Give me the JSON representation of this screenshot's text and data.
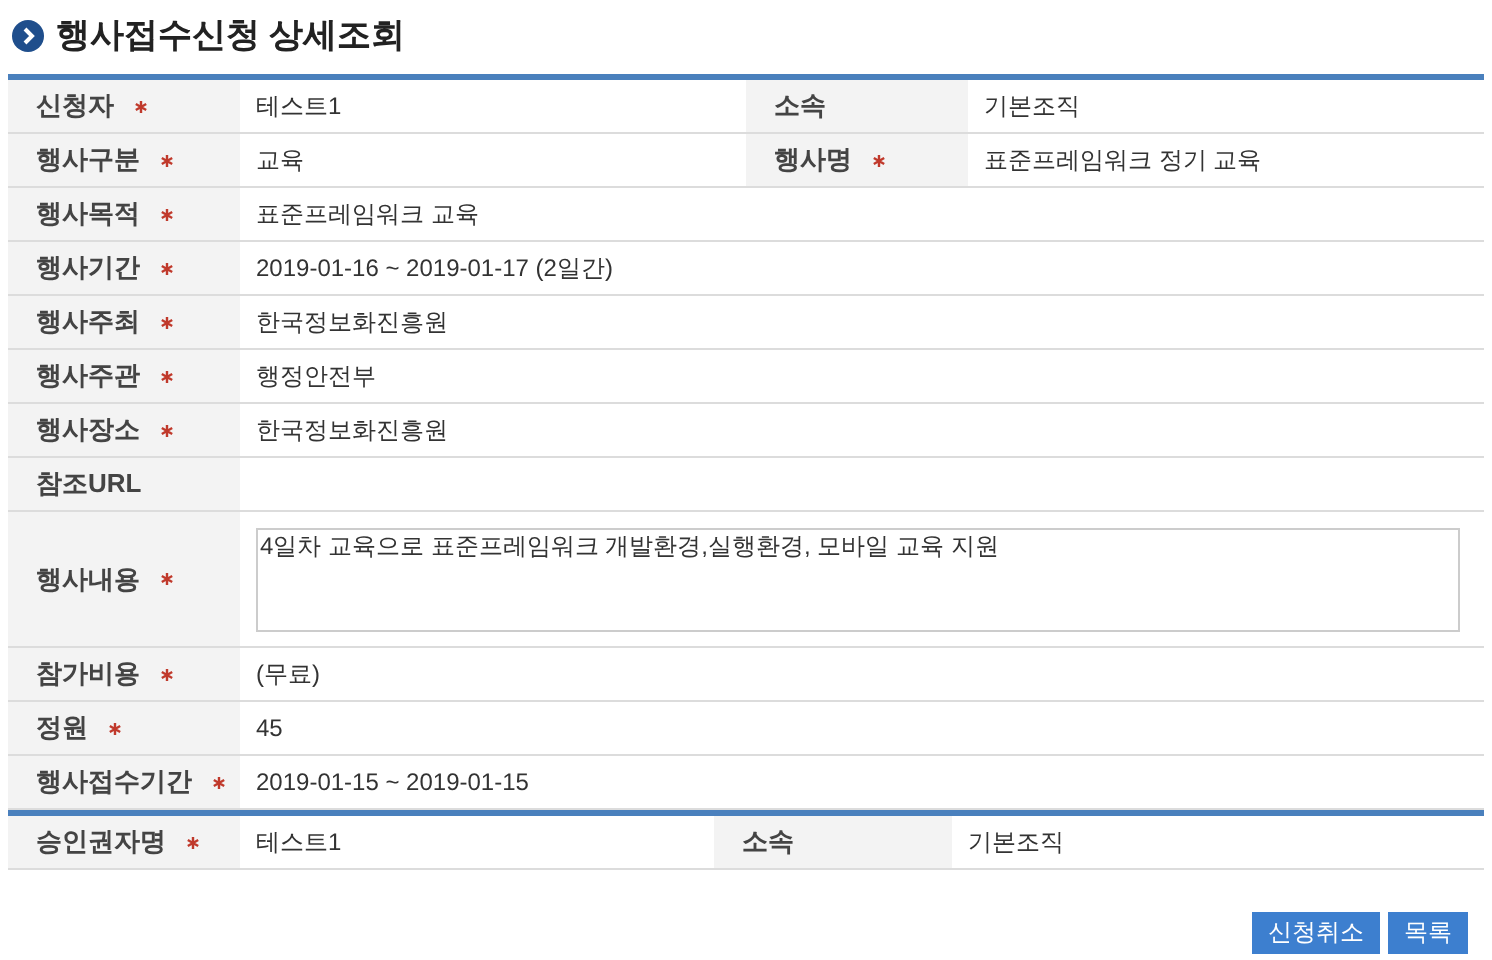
{
  "title": "행사접수신청 상세조회",
  "application": [
    {
      "kind": "pair",
      "label": "신청자",
      "required": true,
      "value": "테스트1",
      "label2": "소속",
      "required2": false,
      "value2": "기본조직"
    },
    {
      "kind": "pair",
      "label": "행사구분",
      "required": true,
      "value": "교육",
      "label2": "행사명",
      "required2": true,
      "value2": "표준프레임워크 정기 교육"
    },
    {
      "kind": "text",
      "label": "행사목적",
      "required": true,
      "value": "표준프레임워크 교육"
    },
    {
      "kind": "text",
      "label": "행사기간",
      "required": true,
      "value": "2019-01-16 ~ 2019-01-17 (2일간)"
    },
    {
      "kind": "text",
      "label": "행사주최",
      "required": true,
      "value": "한국정보화진흥원"
    },
    {
      "kind": "text",
      "label": "행사주관",
      "required": true,
      "value": "행정안전부"
    },
    {
      "kind": "text",
      "label": "행사장소",
      "required": true,
      "value": "한국정보화진흥원"
    },
    {
      "kind": "text",
      "label": "참조URL",
      "required": false
    },
    {
      "kind": "textarea",
      "label": "행사내용",
      "required": true,
      "value": "4일차 교육으로 표준프레임워크 개발환경,실행환경, 모바일 교육 지원"
    },
    {
      "kind": "text",
      "label": "참가비용",
      "required": true,
      "value": "(무료)"
    },
    {
      "kind": "text",
      "label": "정원",
      "required": true,
      "value": "45"
    },
    {
      "kind": "text",
      "label": "행사접수기간",
      "required": true,
      "value": "2019-01-15 ~ 2019-01-15"
    }
  ],
  "approval": [
    {
      "kind": "pair",
      "label": "승인권자명",
      "required": true,
      "value": "테스트1",
      "label2": "소속",
      "required2": false,
      "value2": "기본조직"
    }
  ],
  "buttons": [
    "신청취소",
    "목록"
  ]
}
